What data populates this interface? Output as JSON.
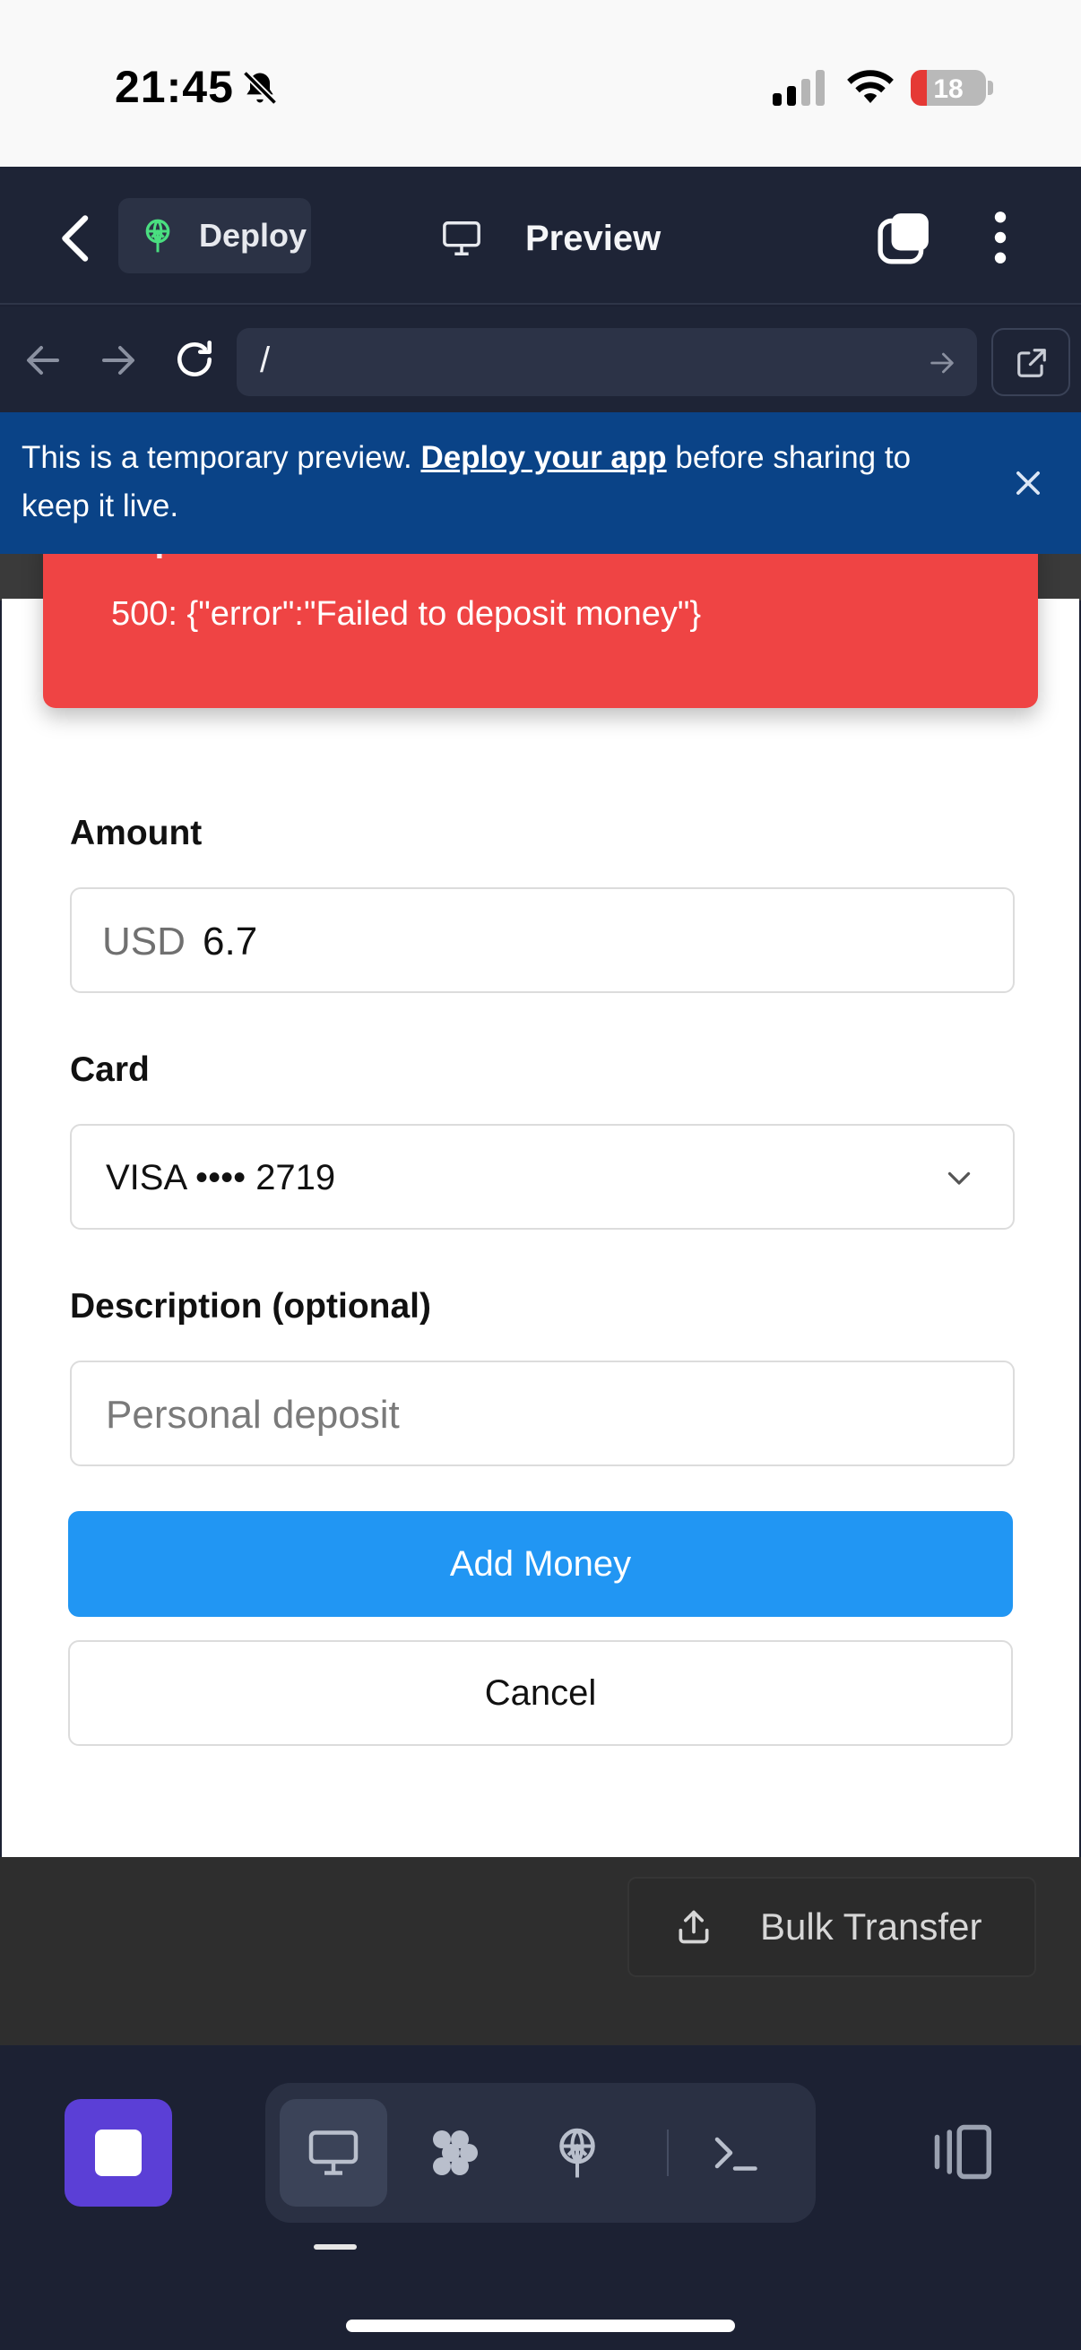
{
  "status_bar": {
    "time": "21:45",
    "battery": "18",
    "icons": [
      "bell-slash-icon",
      "signal-icon",
      "wifi-icon",
      "battery-icon"
    ]
  },
  "header": {
    "deploy_label": "Deploy",
    "title": "Preview"
  },
  "browser": {
    "url": "/"
  },
  "banner": {
    "text_before": "This is a temporary preview. ",
    "link": "Deploy your app",
    "text_after": " before sharing to keep it live."
  },
  "toast": {
    "title": "Deposit failed",
    "message": "500: {\"error\":\"Failed to deposit money\"}"
  },
  "form": {
    "amount_label": "Amount",
    "amount_prefix": "USD",
    "amount_value": "6.7",
    "card_label": "Card",
    "card_value": "VISA •••• 2719",
    "description_label": "Description (optional)",
    "description_placeholder": "Personal deposit",
    "submit_label": "Add Money",
    "cancel_label": "Cancel"
  },
  "background_page": {
    "bulk_transfer_label": "Bulk Transfer"
  },
  "colors": {
    "toast_bg": "#ef4444",
    "primary": "#2196f3",
    "banner_bg": "#0a4387",
    "stop_button": "#5b3fd6"
  }
}
